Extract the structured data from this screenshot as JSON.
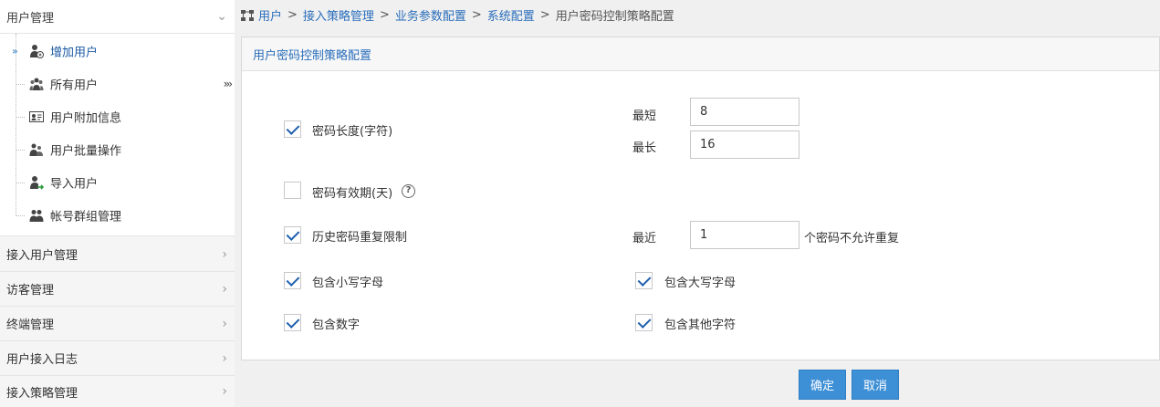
{
  "sidebar": {
    "section_title": "用户管理",
    "items": [
      {
        "label": "增加用户",
        "active": true
      },
      {
        "label": "所有用户"
      },
      {
        "label": "用户附加信息"
      },
      {
        "label": "用户批量操作"
      },
      {
        "label": "导入用户"
      },
      {
        "label": "帐号群组管理"
      }
    ],
    "collapse_label": "›››",
    "sections": [
      "接入用户管理",
      "访客管理",
      "终端管理",
      "用户接入日志",
      "接入策略管理"
    ]
  },
  "breadcrumb": {
    "items": [
      "用户",
      "接入策略管理",
      "业务参数配置",
      "系统配置"
    ],
    "separator": ">",
    "current": "用户密码控制策略配置"
  },
  "panel": {
    "title": "用户密码控制策略配置",
    "length": {
      "label": "密码长度(字符)",
      "checked": true,
      "min_label": "最短",
      "min_value": "8",
      "max_label": "最长",
      "max_value": "16"
    },
    "expiry": {
      "label": "密码有效期(天)",
      "checked": false,
      "help": "?"
    },
    "history": {
      "label": "历史密码重复限制",
      "checked": true,
      "recent_label": "最近",
      "recent_value": "1",
      "suffix": "个密码不允许重复"
    },
    "lowercase": {
      "label": "包含小写字母",
      "checked": true
    },
    "uppercase": {
      "label": "包含大写字母",
      "checked": true
    },
    "digits": {
      "label": "包含数字",
      "checked": true
    },
    "other": {
      "label": "包含其他字符",
      "checked": true
    }
  },
  "buttons": {
    "confirm": "确定",
    "cancel": "取消"
  },
  "colors": {
    "accent": "#3d8fd6",
    "link": "#2a6ebb",
    "check": "#1e5fae"
  }
}
